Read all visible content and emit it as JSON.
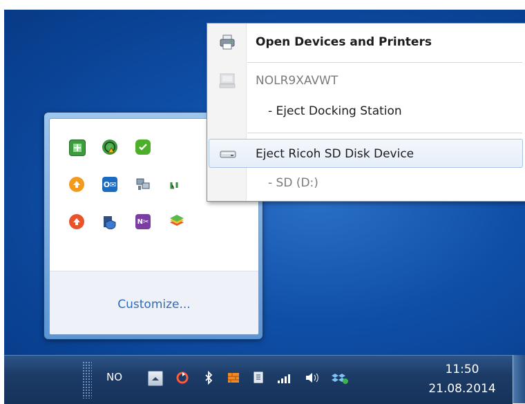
{
  "context_menu": {
    "items": [
      {
        "label": "Open Devices and Printers",
        "icon": "printer-icon"
      },
      {
        "label": "NOLR9XAVWT",
        "icon": "computer-icon"
      },
      {
        "label": "-  Eject Docking Station"
      },
      {
        "label": "Eject Ricoh SD Disk Device",
        "icon": "drive-icon"
      },
      {
        "label": "-  SD (D:)"
      }
    ]
  },
  "tray_overflow": {
    "icons": [
      "green-shield-icon",
      "globe-warning-icon",
      "green-check-icon",
      "orange-up-arrow-icon",
      "outlook-icon",
      "network-computers-icon",
      "red-up-arrow-icon",
      "shield-folder-icon",
      "onenote-clip-icon",
      "stack-layers-icon"
    ],
    "customize_label": "Customize..."
  },
  "taskbar": {
    "language": "NO",
    "clock_time": "11:50",
    "clock_date": "21.08.2014"
  },
  "colors": {
    "desktop": "#0f4fa8",
    "taskbar": "#1c3b66",
    "link": "#2f6bb8"
  }
}
